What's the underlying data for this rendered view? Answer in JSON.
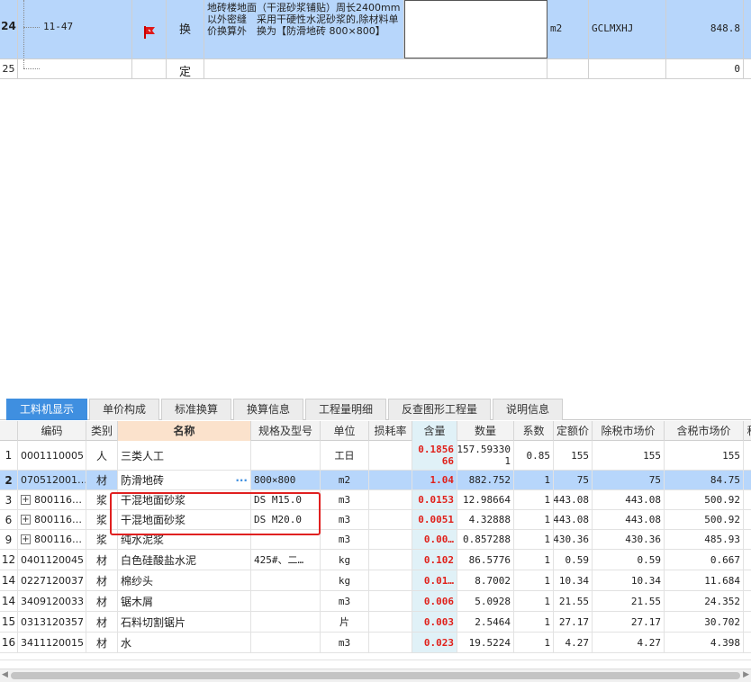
{
  "top_rows": [
    {
      "num": "24",
      "code": "11-47",
      "type": "换",
      "desc": "地砖楼地面（干混砂浆铺贴）周长2400mm以外密缝　采用干硬性水泥砂浆的,除材料单价换算外　换为【防滑地砖 800×800】",
      "unit": "m2",
      "expr": "GCLMXHJ",
      "qty": "848.8"
    },
    {
      "num": "25",
      "code": "",
      "type": "定",
      "desc": "",
      "unit": "",
      "expr": "",
      "qty": "0"
    }
  ],
  "tabs": [
    "工料机显示",
    "单价构成",
    "标准换算",
    "换算信息",
    "工程量明细",
    "反查图形工程量",
    "说明信息"
  ],
  "headers": [
    "编码",
    "类别",
    "名称",
    "规格及型号",
    "单位",
    "损耗率",
    "含量",
    "数量",
    "系数",
    "定额价",
    "除税市场价",
    "含税市场价",
    "税"
  ],
  "rows": [
    {
      "n": "1",
      "code": "0001110005",
      "cat": "人",
      "name": "三类人工",
      "spec": "",
      "unit": "工日",
      "loss": "",
      "qty1": "0.1856",
      "qty2": "66",
      "amt1": "157.59330",
      "amt2": "1",
      "coef": "0.85",
      "price": "155",
      "mkt": "155",
      "tax": "155"
    },
    {
      "n": "2",
      "code": "070512001…",
      "cat": "材",
      "name": "防滑地砖",
      "spec": "800×800",
      "unit": "m2",
      "loss": "",
      "qty1": "1.04",
      "amt1": "882.752",
      "coef": "1",
      "price": "75",
      "mkt": "75",
      "tax": "84.75",
      "more": "···"
    },
    {
      "n": "3",
      "code": "800116…",
      "cat": "浆",
      "name": "干混地面砂浆",
      "spec": "DS M15.0",
      "unit": "m3",
      "loss": "",
      "qty1": "0.0153",
      "amt1": "12.98664",
      "coef": "1",
      "price": "443.08",
      "mkt": "443.08",
      "tax": "500.92",
      "plus": "+"
    },
    {
      "n": "6",
      "code": "800116…",
      "cat": "浆",
      "name": "干混地面砂浆",
      "spec": "DS M20.0",
      "unit": "m3",
      "loss": "",
      "qty1": "0.0051",
      "amt1": "4.32888",
      "coef": "1",
      "price": "443.08",
      "mkt": "443.08",
      "tax": "500.92",
      "plus": "+"
    },
    {
      "n": "9",
      "code": "800116…",
      "cat": "浆",
      "name": "纯水泥浆",
      "spec": "",
      "unit": "m3",
      "loss": "",
      "qty1": "0.00…",
      "amt1": "0.857288",
      "coef": "1",
      "price": "430.36",
      "mkt": "430.36",
      "tax": "485.93",
      "plus": "+"
    },
    {
      "n": "12",
      "code": "0401120045",
      "cat": "材",
      "name": "白色硅酸盐水泥",
      "spec": "425#、二…",
      "unit": "kg",
      "loss": "",
      "qty1": "0.102",
      "amt1": "86.5776",
      "coef": "1",
      "price": "0.59",
      "mkt": "0.59",
      "tax": "0.667"
    },
    {
      "n": "14",
      "code": "0227120037",
      "cat": "材",
      "name": "棉纱头",
      "spec": "",
      "unit": "kg",
      "loss": "",
      "qty1": "0.01…",
      "amt1": "8.7002",
      "coef": "1",
      "price": "10.34",
      "mkt": "10.34",
      "tax": "11.684"
    },
    {
      "n": "14",
      "code": "3409120033",
      "cat": "材",
      "name": "锯木屑",
      "spec": "",
      "unit": "m3",
      "loss": "",
      "qty1": "0.006",
      "amt1": "5.0928",
      "coef": "1",
      "price": "21.55",
      "mkt": "21.55",
      "tax": "24.352"
    },
    {
      "n": "15",
      "code": "0313120357",
      "cat": "材",
      "name": "石料切割锯片",
      "spec": "",
      "unit": "片",
      "loss": "",
      "qty1": "0.003",
      "amt1": "2.5464",
      "coef": "1",
      "price": "27.17",
      "mkt": "27.17",
      "tax": "30.702"
    },
    {
      "n": "16",
      "code": "3411120015",
      "cat": "材",
      "name": "水",
      "spec": "",
      "unit": "m3",
      "loss": "",
      "qty1": "0.023",
      "amt1": "19.5224",
      "coef": "1",
      "price": "4.27",
      "mkt": "4.27",
      "tax": "4.398"
    }
  ]
}
